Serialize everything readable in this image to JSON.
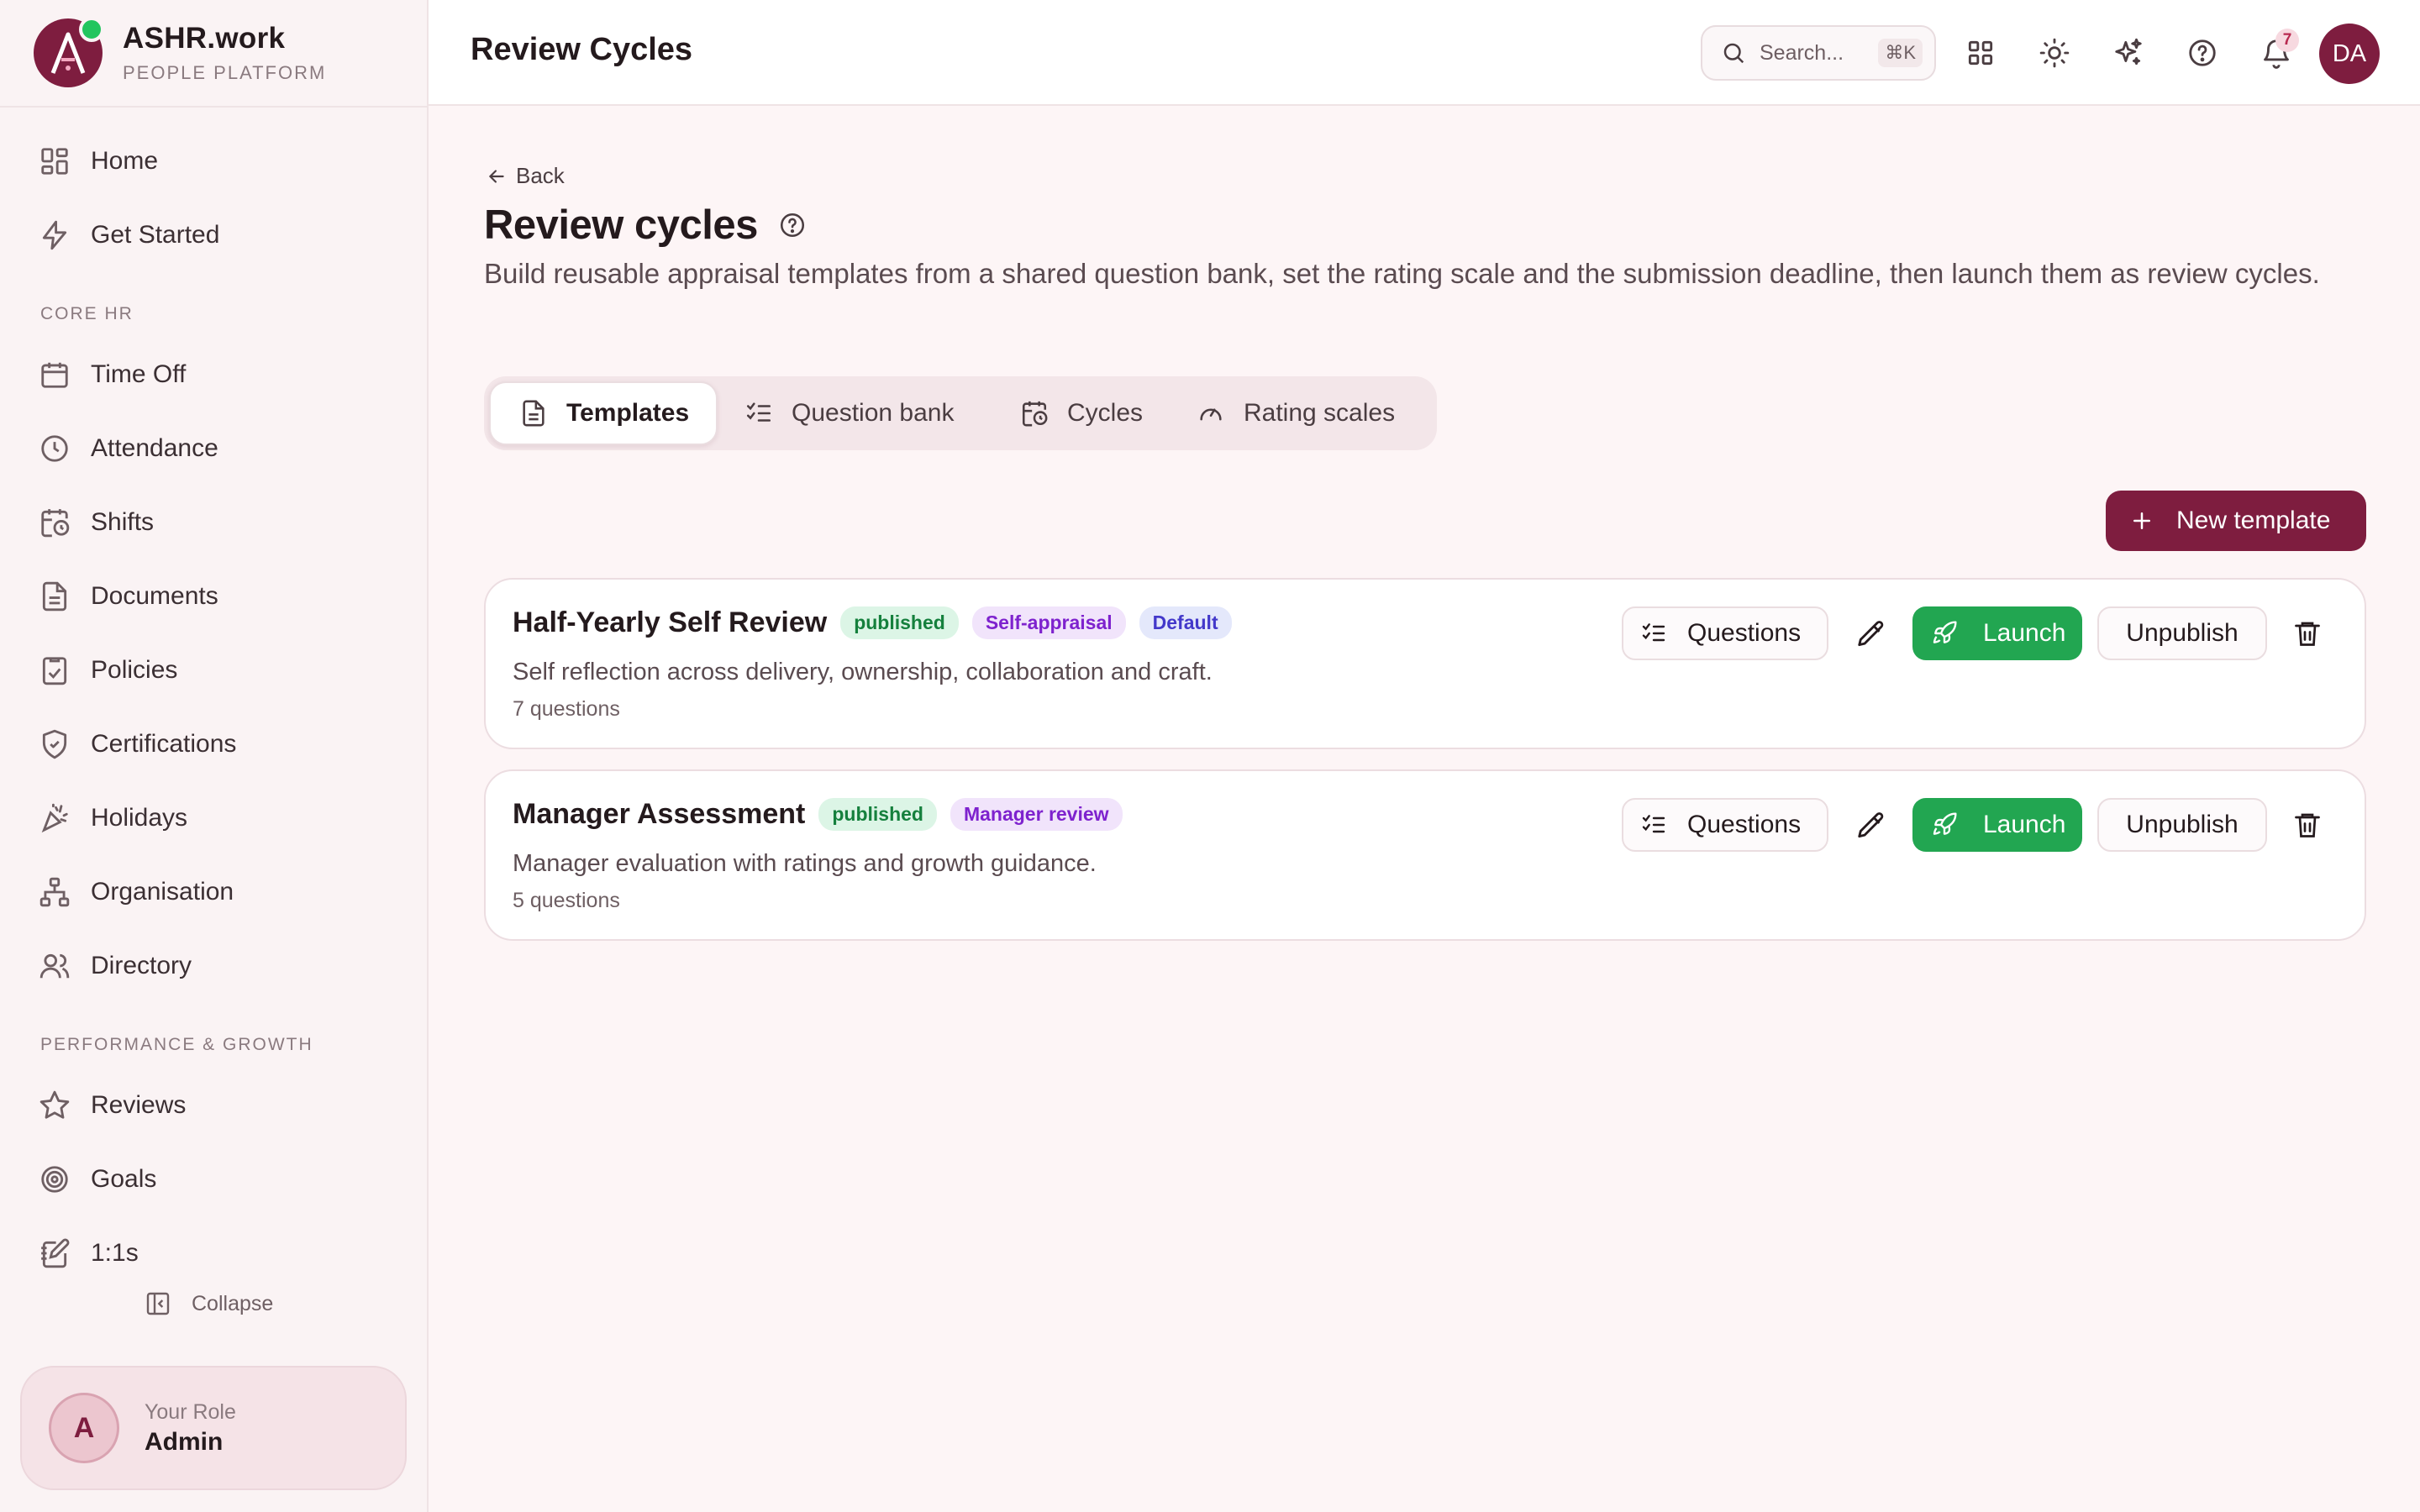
{
  "brand": {
    "name": "ASHR.work",
    "subtitle": "PEOPLE PLATFORM",
    "logo_letter": "A"
  },
  "sidebar": {
    "items": [
      {
        "label": "Home",
        "icon": "grid-icon"
      },
      {
        "label": "Get Started",
        "icon": "bolt-icon"
      }
    ],
    "sections": [
      {
        "title": "CORE HR",
        "items": [
          {
            "label": "Time Off",
            "icon": "calendar-icon"
          },
          {
            "label": "Attendance",
            "icon": "clock-icon"
          },
          {
            "label": "Shifts",
            "icon": "calendar-clock-icon"
          },
          {
            "label": "Documents",
            "icon": "document-icon"
          },
          {
            "label": "Policies",
            "icon": "clipboard-check-icon"
          },
          {
            "label": "Certifications",
            "icon": "shield-check-icon"
          },
          {
            "label": "Holidays",
            "icon": "party-popper-icon"
          },
          {
            "label": "Organisation",
            "icon": "org-chart-icon"
          },
          {
            "label": "Directory",
            "icon": "users-icon"
          }
        ]
      },
      {
        "title": "PERFORMANCE & GROWTH",
        "items": [
          {
            "label": "Reviews",
            "icon": "star-icon"
          },
          {
            "label": "Goals",
            "icon": "target-icon"
          },
          {
            "label": "1:1s",
            "icon": "notebook-pen-icon"
          }
        ]
      }
    ],
    "collapse_label": "Collapse",
    "role": {
      "caption": "Your Role",
      "value": "Admin",
      "avatar_letter": "A"
    }
  },
  "topbar": {
    "title": "Review Cycles",
    "search_placeholder": "Search...",
    "search_shortcut": "⌘K",
    "notification_count": "7",
    "user_initials": "DA"
  },
  "main": {
    "back_label": "Back",
    "title": "Review cycles",
    "description": "Build reusable appraisal templates from a shared question bank, set the rating scale and the submission deadline, then launch them as review cycles.",
    "tabs": [
      {
        "label": "Templates",
        "active": true
      },
      {
        "label": "Question bank",
        "active": false
      },
      {
        "label": "Cycles",
        "active": false
      },
      {
        "label": "Rating scales",
        "active": false
      }
    ],
    "new_template_label": "New template",
    "templates": [
      {
        "name": "Half-Yearly Self Review",
        "status": "published",
        "type": "Self-appraisal",
        "default_badge": "Default",
        "description": "Self reflection across delivery, ownership, collaboration and craft.",
        "question_count": "7 questions"
      },
      {
        "name": "Manager Assessment",
        "status": "published",
        "type": "Manager review",
        "description": "Manager evaluation with ratings and growth guidance.",
        "question_count": "5 questions"
      }
    ],
    "actions": {
      "questions": "Questions",
      "launch": "Launch",
      "unpublish": "Unpublish"
    }
  },
  "colors": {
    "brand": "#7e1d3f",
    "launch": "#22a651",
    "published_bg": "#dcf5e6",
    "background": "#fdf5f6"
  }
}
